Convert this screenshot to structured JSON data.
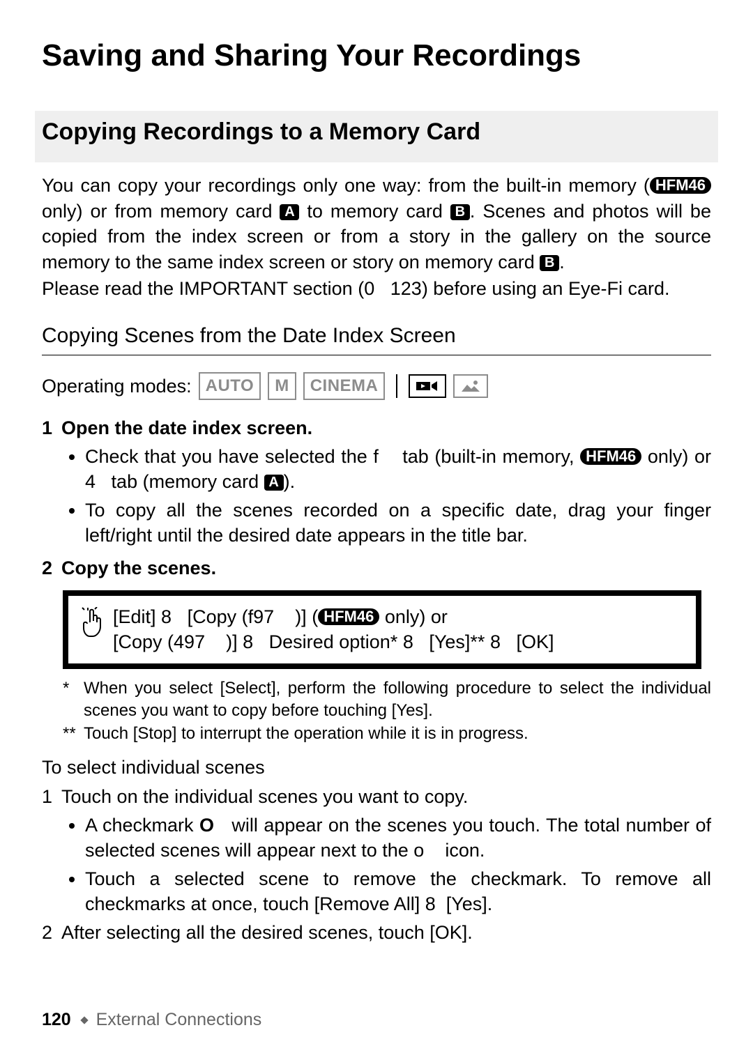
{
  "chapterTitle": "Saving and Sharing Your Recordings",
  "section": {
    "title": "Copying Recordings to a Memory Card",
    "intro1a": "You can copy your recordings only one way: from the built-in memory (",
    "model": "HFM46",
    "intro1b": " only) or from memory card ",
    "cardA": "A",
    "intro1c": " to memory card ",
    "cardB": "B",
    "intro1d": ". Scenes and photos will be copied from the index screen or from a story in the gallery on the source memory to the same index screen or story on memory card ",
    "intro1e": ".",
    "intro2a": "Please Please read the IMPORTANT section (",
    "pageRef": "123",
    "intro2b": ") before using an Eye-Fi card."
  },
  "subSection": {
    "title": "Copying Scenes from the Date Index Screen",
    "modesLabel": "Operating modes:",
    "modes": [
      "AUTO",
      "M",
      "CINEMA"
    ]
  },
  "steps": {
    "step1Head": "Open the date index screen.",
    "step1b1a": "Check that you have selected the ",
    "step1b1tab": "f",
    "step1b1b": " tab (built-in memory, ",
    "step1b1c": " only) or ",
    "step1b1tab2": "4",
    "step1b1d": " tab (memory card ",
    "step1b1e": ").",
    "step1b2": "To copy all the scenes recorded on a specific date, drag your finger left/right until the desired date appears in the title bar.",
    "step2Head": "Copy the scenes."
  },
  "touchSeq": {
    "edit": "[Edit]",
    "arrow": "8",
    "copy1a": "[Copy (",
    "copy1glyph": "f97",
    "copy1b": ")]",
    "onlyOr": "only) or",
    "copy2a": "[Copy (",
    "copy2glyph": "497",
    "copy2b": ")]",
    "desired": "Desired option*",
    "yes": "[Yes]**",
    "ok": "[OK]"
  },
  "footnotes": {
    "fn1": "When you select [Select], perform the following procedure to select the individual scenes you want to copy before touching [Yes].",
    "fn2": "Touch [Stop] to interrupt the operation while it is in progress."
  },
  "select": {
    "heading": "To select individual scenes",
    "s1": "Touch on the individual scenes you want to copy.",
    "s1b1a": "A checkmark ",
    "s1b1check": "O",
    "s1b1b": " will appear on the scenes you touch. The total number of selected scenes will appear next to the ",
    "s1b1icon": "o",
    "s1b1c": " icon.",
    "s1b2": "Touch a selected scene to remove the checkmark. To remove all checkmarks at once, touch [Remove All] 8 [Yes].",
    "s2": "After selecting all the desired scenes, touch [OK]."
  },
  "footer": {
    "pageNum": "120",
    "section": "External Connections"
  }
}
